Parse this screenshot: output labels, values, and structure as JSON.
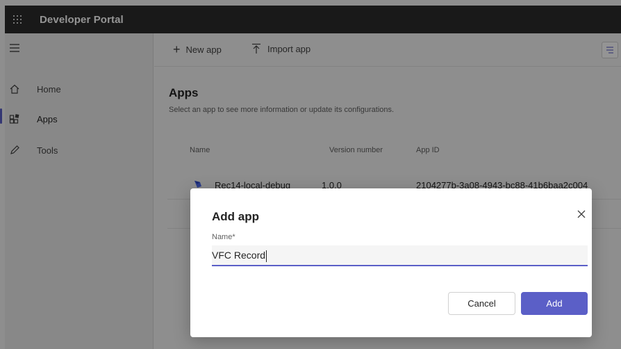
{
  "header": {
    "title": "Developer Portal",
    "waffle_icon": "app-launcher-icon"
  },
  "sidebar": {
    "menu_icon": "hamburger-icon",
    "items": [
      {
        "label": "Home",
        "icon": "home-icon"
      },
      {
        "label": "Apps",
        "icon": "apps-icon",
        "active": true
      },
      {
        "label": "Tools",
        "icon": "pencil-icon"
      }
    ]
  },
  "commands": {
    "new_app": "New app",
    "import_app": "Import app"
  },
  "main": {
    "title": "Apps",
    "subtitle": "Select an app to see more information or update its configurations.",
    "columns": [
      "Name",
      "Version number",
      "App ID"
    ],
    "rows": [
      {
        "name": "Rec14-local-debug",
        "version": "1.0.0",
        "app_id": "2104277b-3a08-4943-bc88-41b6baa2c004"
      }
    ]
  },
  "dialog": {
    "title": "Add app",
    "field_label": "Name*",
    "field_value": "VFC Record",
    "cancel_label": "Cancel",
    "add_label": "Add"
  },
  "colors": {
    "accent": "#5b5fc7",
    "topbar": "#2b2b2b"
  }
}
